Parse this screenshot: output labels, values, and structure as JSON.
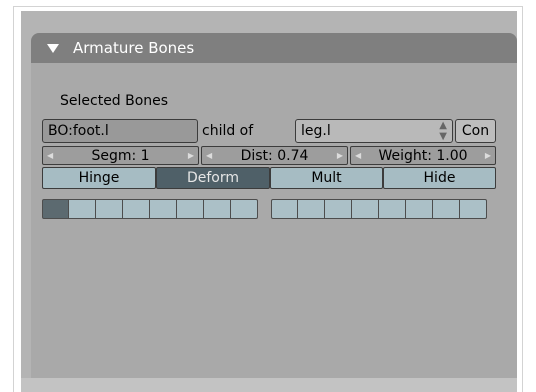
{
  "panel": {
    "title": "Armature Bones",
    "section_label": "Selected Bones"
  },
  "bone": {
    "name": "BO:foot.l",
    "child_of_label": "child of",
    "parent": "leg.l",
    "con_label": "Con"
  },
  "numbers": {
    "segm": "Segm: 1",
    "dist": "Dist: 0.74",
    "weight": "Weight: 1.00"
  },
  "toggles": [
    {
      "label": "Hinge",
      "active": false
    },
    {
      "label": "Deform",
      "active": true
    },
    {
      "label": "Mult",
      "active": false
    },
    {
      "label": "Hide",
      "active": false
    }
  ],
  "layers": {
    "group_a": [
      true,
      false,
      false,
      false,
      false,
      false,
      false,
      false
    ],
    "group_b": [
      false,
      false,
      false,
      false,
      false,
      false,
      false,
      false
    ]
  },
  "icons": {
    "collapse": "triangle-down-icon",
    "menu_arrows": "up-down-arrow-icon",
    "num_left": "arrow-left-icon",
    "num_right": "arrow-right-icon"
  }
}
